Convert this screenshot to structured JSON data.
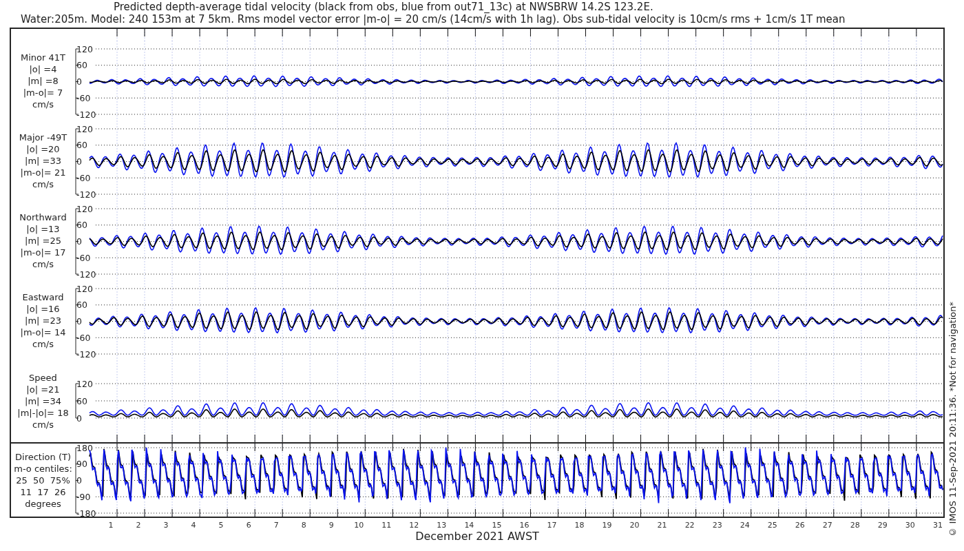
{
  "title": [
    "Predicted depth-average tidal velocity (black from obs, blue from out71_13c) at NWSBRW 14.2S 123.2E.",
    "Water:205m. Model: 240 153m at 7 5km. Rms model vector error |m-o| = 20 cm/s (14cm/s with 1h lag). Obs sub-tidal velocity is 10cm/s rms + 1cm/s 1T mean"
  ],
  "panels": [
    {
      "kind": "velocity",
      "label": [
        "Minor 41T",
        "|o| =4",
        "|m| =8",
        "|m-o|= 7",
        "cm/s"
      ],
      "yticks": [
        "120",
        "60",
        "0",
        "-60",
        "-120"
      ]
    },
    {
      "kind": "velocity",
      "label": [
        "Major -49T",
        "|o| =20",
        "|m| =33",
        "|m-o|= 21",
        "cm/s"
      ],
      "yticks": [
        "120",
        "60",
        "0",
        "-60",
        "-120"
      ]
    },
    {
      "kind": "velocity",
      "label": [
        "Northward",
        "|o| =13",
        "|m| =25",
        "|m-o|= 17",
        "cm/s"
      ],
      "yticks": [
        "120",
        "60",
        "0",
        "-60",
        "-120"
      ]
    },
    {
      "kind": "velocity",
      "label": [
        "Eastward",
        "|o| =16",
        "|m| =23",
        "|m-o|= 14",
        "cm/s"
      ],
      "yticks": [
        "120",
        "60",
        "0",
        "-60",
        "-120"
      ]
    },
    {
      "kind": "speed",
      "label": [
        "Speed",
        "|o| =21",
        "|m| =34",
        "|m|-|o|= 18",
        "cm/s"
      ],
      "yticks": [
        "120",
        "60",
        "0"
      ]
    }
  ],
  "direction_panel": {
    "kind": "direction",
    "label": [
      "Direction (T)",
      "m-o centiles:",
      "25  50  75%",
      "11  17  26",
      "degrees"
    ],
    "yticks": [
      "180",
      "90",
      "0",
      "-90",
      "-180"
    ]
  },
  "xticks": [
    "1",
    "2",
    "3",
    "4",
    "5",
    "6",
    "7",
    "8",
    "9",
    "10",
    "11",
    "12",
    "13",
    "14",
    "15",
    "16",
    "17",
    "18",
    "19",
    "20",
    "21",
    "22",
    "23",
    "24",
    "25",
    "26",
    "27",
    "28",
    "29",
    "30",
    "31"
  ],
  "xlabel": "December 2021 AWST",
  "credit": "© IMOS 11-Sep-2021 20:11:36. *Not for navigation*"
}
